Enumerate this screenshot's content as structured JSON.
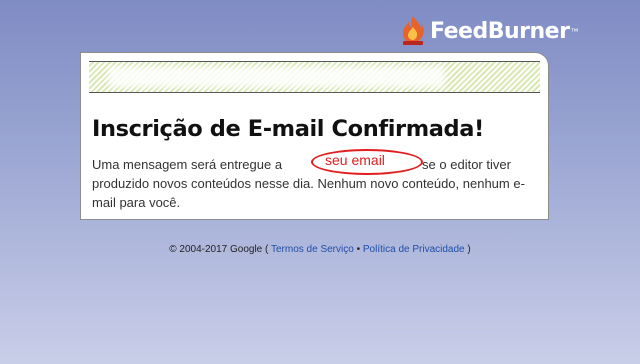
{
  "brand": {
    "name": "FeedBurner",
    "tm": "™"
  },
  "card": {
    "title": "Inscrição de E-mail Confirmada!",
    "message_before": "Uma mensagem será entregue a",
    "message_after": "se o editor tiver produzido novos conteúdos nesse dia. Nenhum novo conteúdo, nenhum e-mail para você.",
    "highlight_text": "seu email",
    "highlight_color": "#e01e1e"
  },
  "footer": {
    "copyright": "© 2004-2017 Google",
    "open_paren": "(",
    "terms": "Termos de Serviço",
    "separator": "•",
    "privacy": "Política de Privacidade",
    "close_paren": ")"
  },
  "colors": {
    "link": "#1f4fa8",
    "stripe": "#d7e8b2"
  }
}
